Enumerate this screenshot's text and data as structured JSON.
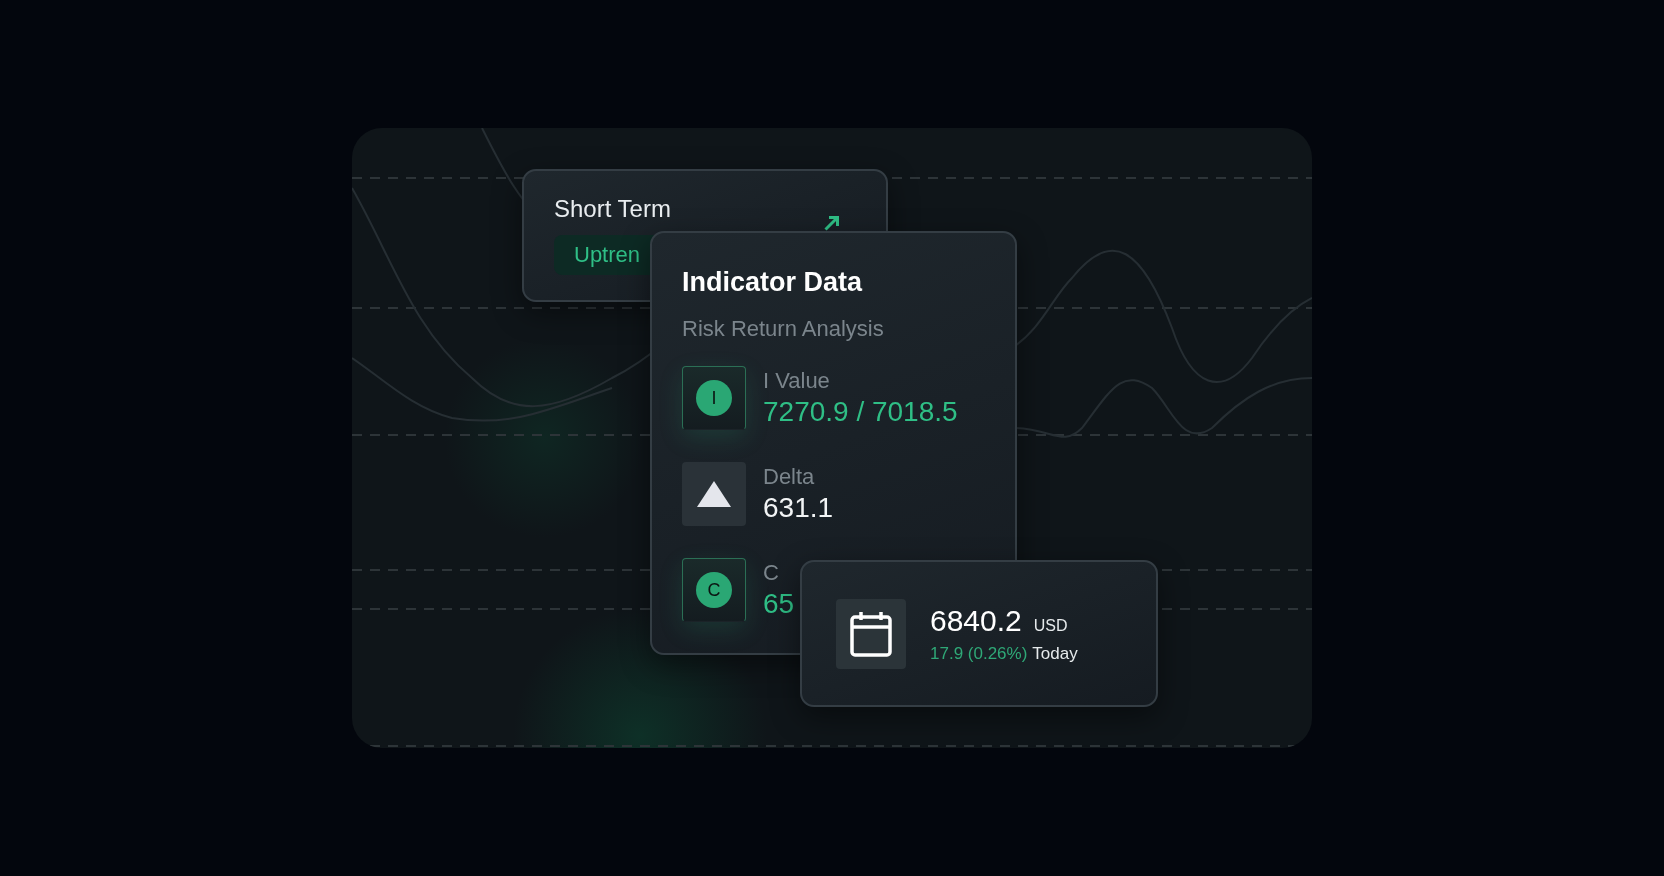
{
  "short_term_card": {
    "title": "Short Term",
    "badge": "Uptren"
  },
  "indicator_card": {
    "title": "Indicator Data",
    "subtitle": "Risk Return Analysis",
    "rows": [
      {
        "kind": "letter",
        "icon_text": "I",
        "label": "I Value",
        "value": "7270.9 / 7018.5",
        "color": "#2fbf86"
      },
      {
        "kind": "triangle",
        "label": "Delta",
        "value": "631.1",
        "color": "#f2f4f5"
      },
      {
        "kind": "letter",
        "icon_text": "C",
        "label": "C",
        "value": "65",
        "color": "#2fbf86"
      }
    ]
  },
  "price_card": {
    "amount": "6840.2",
    "currency": "USD",
    "change": "17.9 (0.26%)",
    "period": "Today"
  }
}
